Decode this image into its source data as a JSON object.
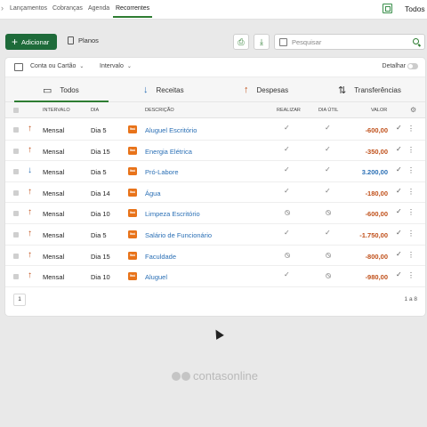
{
  "topnav": {
    "tabs": [
      "Lançamentos",
      "Cobranças",
      "Agenda",
      "Recorrentes"
    ],
    "active_tab": "Recorrentes",
    "right_label": "Todos o"
  },
  "toolbar": {
    "add_label": "Adicionar",
    "planos_label": "Planos",
    "search_placeholder": "Pesquisar"
  },
  "filters": {
    "account_label": "Conta ou Cartão",
    "interval_label": "Intervalo",
    "detail_label": "Detalhar"
  },
  "type_tabs": [
    "Todos",
    "Receitas",
    "Despesas",
    "Transferências"
  ],
  "table": {
    "headers": {
      "intervalo": "INTERVALO",
      "dia": "DIA",
      "descricao": "DESCRIÇÃO",
      "realizar": "REALIZAR",
      "dia_util": "DIA ÚTIL",
      "valor": "VALOR"
    },
    "bank_badge": "Itaú",
    "rows": [
      {
        "type": "expense",
        "intervalo": "Mensal",
        "dia": "Dia 5",
        "descricao": "Aluguel Escritório",
        "realizar": true,
        "dia_util": true,
        "valor": "-600,00"
      },
      {
        "type": "expense",
        "intervalo": "Mensal",
        "dia": "Dia 15",
        "descricao": "Energia Elétrica",
        "realizar": true,
        "dia_util": true,
        "valor": "-350,00"
      },
      {
        "type": "income",
        "intervalo": "Mensal",
        "dia": "Dia 5",
        "descricao": "Pró-Labore",
        "realizar": true,
        "dia_util": true,
        "valor": "3.200,00"
      },
      {
        "type": "expense",
        "intervalo": "Mensal",
        "dia": "Dia 14",
        "descricao": "Água",
        "realizar": true,
        "dia_util": true,
        "valor": "-180,00"
      },
      {
        "type": "expense",
        "intervalo": "Mensal",
        "dia": "Dia 10",
        "descricao": "Limpeza Escritório",
        "realizar": false,
        "dia_util": false,
        "valor": "-600,00"
      },
      {
        "type": "expense",
        "intervalo": "Mensal",
        "dia": "Dia 5",
        "descricao": "Salário de Funcionário",
        "realizar": true,
        "dia_util": true,
        "valor": "-1.750,00"
      },
      {
        "type": "expense",
        "intervalo": "Mensal",
        "dia": "Dia 15",
        "descricao": "Faculdade",
        "realizar": false,
        "dia_util": false,
        "valor": "-800,00"
      },
      {
        "type": "expense",
        "intervalo": "Mensal",
        "dia": "Dia 10",
        "descricao": "Aluguel",
        "realizar": true,
        "dia_util": false,
        "valor": "-980,00"
      }
    ]
  },
  "pagination": {
    "page": "1",
    "info": "1 a 8"
  },
  "brand": "contasonline",
  "colors": {
    "primary": "#1e6b3a",
    "expense": "#c0501a",
    "income": "#2a6fb5",
    "bank": "#e8731a"
  },
  "icons": {
    "expense": "arrow-up-icon",
    "income": "arrow-down-icon"
  }
}
